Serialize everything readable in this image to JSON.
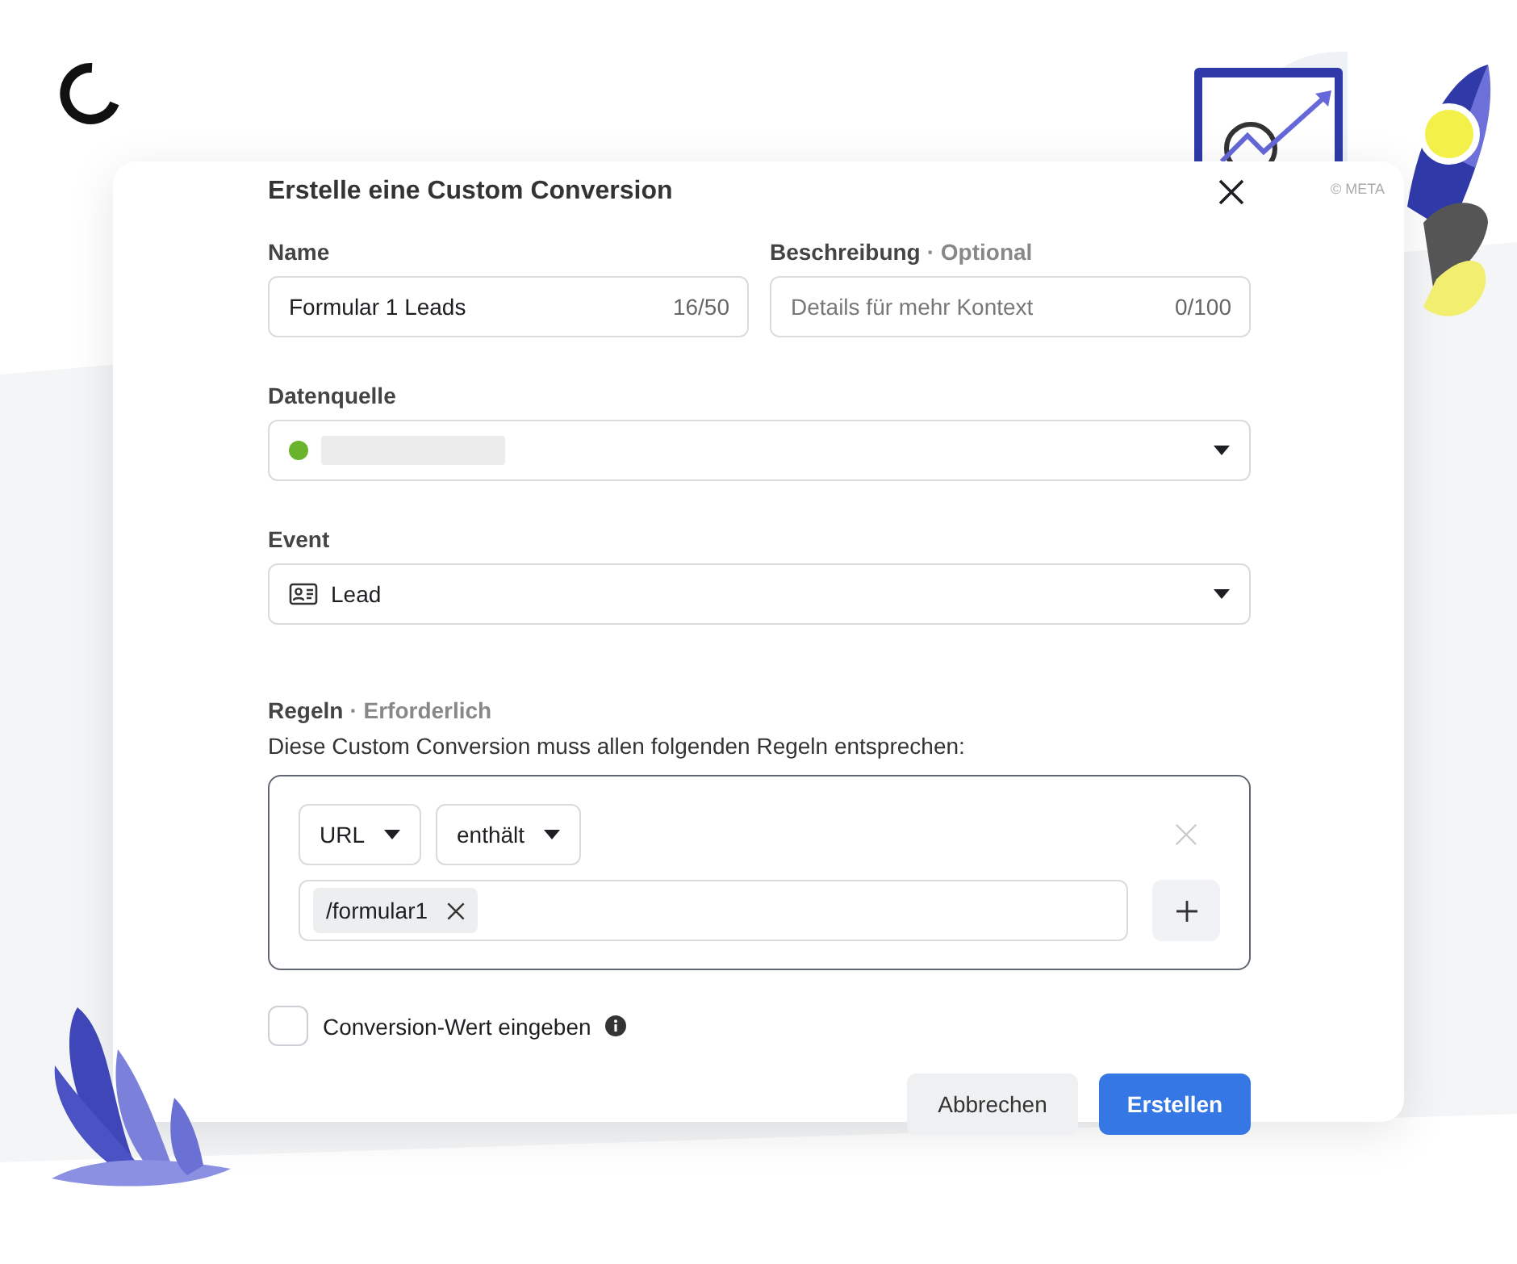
{
  "dialog": {
    "title": "Erstelle eine Custom Conversion",
    "copyright": "© META",
    "fields": [
      {
        "kind": "text",
        "label": "Name",
        "value": "Formular 1 Leads",
        "counter": "16/50"
      },
      {
        "kind": "text",
        "label": "Beschreibung",
        "label_suffix": "· Optional",
        "placeholder": "Details für mehr Kontext",
        "counter": "0/100"
      }
    ],
    "data_source": {
      "label": "Datenquelle",
      "redacted": true
    },
    "event": {
      "label": "Event",
      "value": "Lead"
    },
    "rules": {
      "label": "Regeln",
      "label_suffix": "· Erforderlich",
      "description": "Diese Custom Conversion muss allen folgenden Regeln entsprechen:",
      "selects": [
        "URL",
        "enthält"
      ],
      "remove_disabled": true,
      "tags": [
        "/formular1"
      ]
    },
    "checkbox": {
      "label": "Conversion-Wert eingeben",
      "checked": false
    },
    "buttons": [
      {
        "label": "Abbrechen",
        "kind": "secondary"
      },
      {
        "label": "Erstellen",
        "kind": "primary"
      }
    ]
  }
}
